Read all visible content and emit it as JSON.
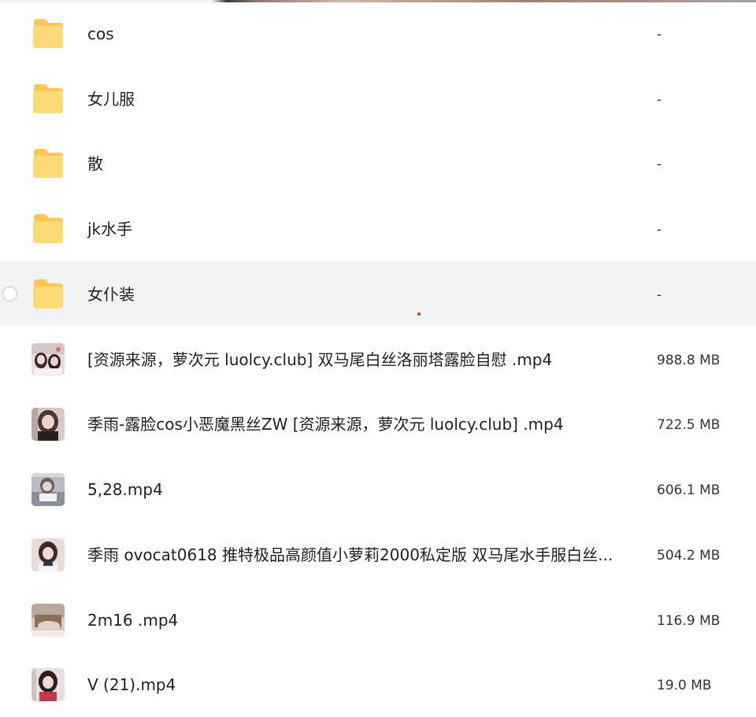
{
  "folders": [
    {
      "name": "cos",
      "size": "-"
    },
    {
      "name": "女儿服",
      "size": "-"
    },
    {
      "name": "散",
      "size": "-"
    },
    {
      "name": "jk水手",
      "size": "-"
    },
    {
      "name": "女仆装",
      "size": "-"
    }
  ],
  "files": [
    {
      "name": "[资源来源，萝次元 luolcy.club] 双马尾白丝洛丽塔露脸自慰 .mp4",
      "size": "988.8 MB"
    },
    {
      "name": "季雨-露脸cos小恶魔黑丝ZW [资源来源，萝次元 luolcy.club] .mp4",
      "size": "722.5 MB"
    },
    {
      "name": "5,28.mp4",
      "size": "606.1 MB"
    },
    {
      "name": "季雨 ovocat0618 推特极品高颜值小萝莉2000私定版 双马尾水手服白丝...",
      "size": "504.2 MB"
    },
    {
      "name": "2m16 .mp4",
      "size": "116.9 MB"
    },
    {
      "name": "V (21).mp4",
      "size": "19.0 MB"
    }
  ],
  "colors": {
    "folder_body": "#fcc84f",
    "folder_front": "#fdd978",
    "selected_row": "#f1f3f5"
  },
  "icons": {
    "folder": "folder-icon",
    "video": "video-thumbnail"
  }
}
